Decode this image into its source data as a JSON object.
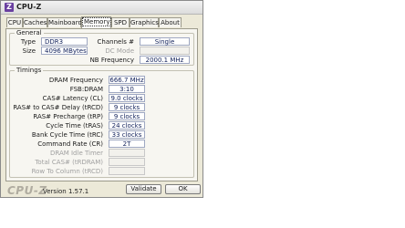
{
  "window": {
    "title": "CPU-Z",
    "icon": "cpu-z-app-icon"
  },
  "tabs": [
    {
      "label": "CPU",
      "active": false
    },
    {
      "label": "Caches",
      "active": false
    },
    {
      "label": "Mainboard",
      "active": false
    },
    {
      "label": "Memory",
      "active": true
    },
    {
      "label": "SPD",
      "active": false
    },
    {
      "label": "Graphics",
      "active": false
    },
    {
      "label": "About",
      "active": false
    }
  ],
  "general": {
    "legend": "General",
    "type_label": "Type",
    "type_value": "DDR3",
    "size_label": "Size",
    "size_value": "4096 MBytes",
    "channels_label": "Channels #",
    "channels_value": "Single",
    "dc_mode_label": "DC Mode",
    "dc_mode_value": "",
    "nb_freq_label": "NB Frequency",
    "nb_freq_value": "2000.1 MHz"
  },
  "timings": {
    "legend": "Timings",
    "rows": [
      {
        "label": "DRAM Frequency",
        "value": "666.7 MHz"
      },
      {
        "label": "FSB:DRAM",
        "value": "3:10"
      },
      {
        "label": "CAS# Latency (CL)",
        "value": "9.0 clocks"
      },
      {
        "label": "RAS# to CAS# Delay (tRCD)",
        "value": "9 clocks"
      },
      {
        "label": "RAS# Precharge (tRP)",
        "value": "9 clocks"
      },
      {
        "label": "Cycle Time (tRAS)",
        "value": "24 clocks"
      },
      {
        "label": "Bank Cycle Time (tRC)",
        "value": "33 clocks"
      },
      {
        "label": "Command Rate (CR)",
        "value": "2T"
      },
      {
        "label": "DRAM Idle Timer",
        "value": ""
      },
      {
        "label": "Total CAS# (tRDRAM)",
        "value": ""
      },
      {
        "label": "Row To Column (tRCD)",
        "value": ""
      }
    ]
  },
  "footer": {
    "logo": "CPU-Z",
    "version": "Version 1.57.1",
    "validate_label": "Validate",
    "ok_label": "OK"
  }
}
